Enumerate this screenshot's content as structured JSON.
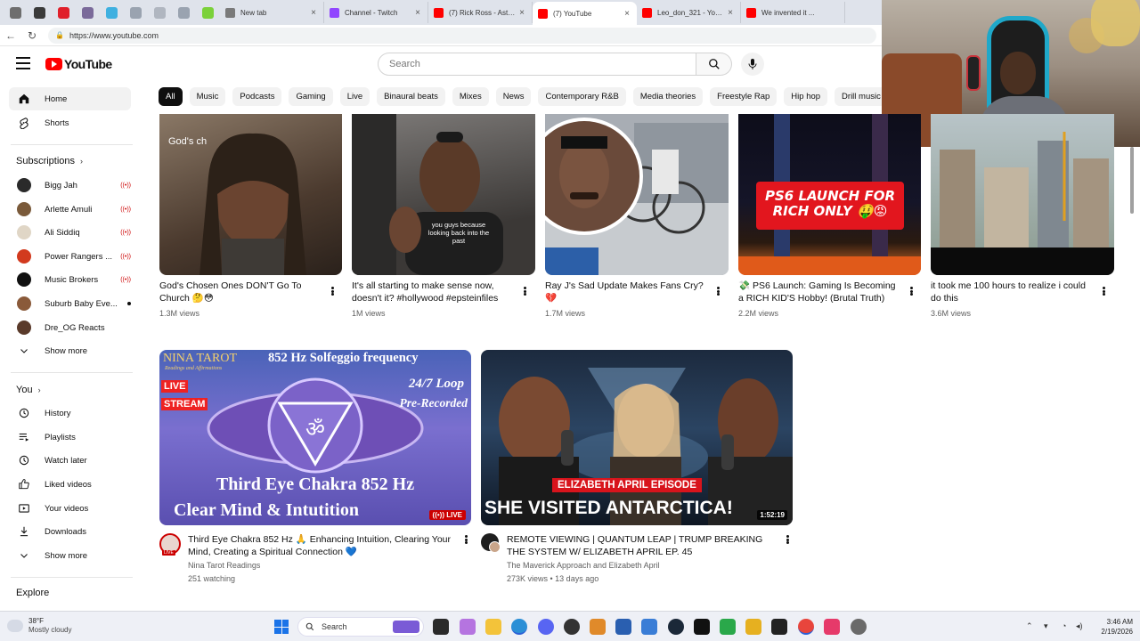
{
  "browser": {
    "tabs": [
      {
        "title": "New tab",
        "favicon_color": "#7a7a7a"
      },
      {
        "title": "Channel - Twitch",
        "favicon_color": "#9146ff"
      },
      {
        "title": "(7) Rick Ross - Aston M...",
        "favicon_color": "#ff0000"
      },
      {
        "title": "(7) YouTube",
        "favicon_color": "#ff0000",
        "active": true
      },
      {
        "title": "Leo_don_321 - YouTub...",
        "favicon_color": "#ff0000"
      },
      {
        "title": "We invented it ...",
        "favicon_color": "#ff0000"
      }
    ],
    "url": "https://www.youtube.com"
  },
  "header": {
    "logo_text": "YouTube",
    "search_placeholder": "Search"
  },
  "chips": [
    "All",
    "Music",
    "Podcasts",
    "Gaming",
    "Live",
    "Binaural beats",
    "Mixes",
    "News",
    "Contemporary R&B",
    "Media theories",
    "Freestyle Rap",
    "Hip hop",
    "Drill music"
  ],
  "sidebar": {
    "main": [
      {
        "label": "Home",
        "icon": "home-icon"
      },
      {
        "label": "Shorts",
        "icon": "shorts-icon"
      }
    ],
    "subscriptions_title": "Subscriptions",
    "subscriptions": [
      {
        "label": "Bigg Jah",
        "avatar_color": "#2a2a2a",
        "status": "live"
      },
      {
        "label": "Arlette Amuli",
        "avatar_color": "#7a5a3a",
        "status": "live"
      },
      {
        "label": "Ali Siddiq",
        "avatar_color": "#e0d6c6",
        "status": "live"
      },
      {
        "label": "Power Rangers ...",
        "avatar_color": "#d23a1e",
        "status": "live"
      },
      {
        "label": "Music Brokers",
        "avatar_color": "#111111",
        "status": "live"
      },
      {
        "label": "Suburb Baby Eve...",
        "avatar_color": "#8a5a3a",
        "status": "dot"
      },
      {
        "label": "Dre_OG Reacts",
        "avatar_color": "#5a3a2a",
        "status": ""
      }
    ],
    "show_more_1": "Show more",
    "you_title": "You",
    "you_items": [
      {
        "label": "History",
        "icon": "history-icon"
      },
      {
        "label": "Playlists",
        "icon": "playlists-icon"
      },
      {
        "label": "Watch later",
        "icon": "watch-later-icon"
      },
      {
        "label": "Liked videos",
        "icon": "like-icon"
      },
      {
        "label": "Your videos",
        "icon": "your-videos-icon"
      },
      {
        "label": "Downloads",
        "icon": "download-icon"
      }
    ],
    "show_more_2": "Show more",
    "explore_title": "Explore"
  },
  "videos_row1": [
    {
      "title": "God's Chosen Ones DON'T Go To Church 🤔😳",
      "meta": "1.3M views",
      "thumb_text": "God's ch",
      "thumb_bg": "#6b5a4c"
    },
    {
      "title": "It's all starting to make sense now, doesn't it? #hollywood #epsteinfiles",
      "meta": "1M views",
      "thumb_text": "you guys because looking back into the past",
      "thumb_bg": "#4f4a48"
    },
    {
      "title": "Ray J's Sad Update Makes Fans Cry? 💔",
      "meta": "1.7M views",
      "thumb_text": "",
      "thumb_bg": "#8a8f98"
    },
    {
      "title": "💸 PS6 Launch: Gaming Is Becoming a RICH KID'S Hobby! (Brutal Truth)",
      "meta": "2.2M views",
      "thumb_text": "PS6 LAUNCH FOR RICH ONLY 🤑😡",
      "thumb_bg": "#1a1a2a"
    },
    {
      "title": "it took me 100 hours to realize i could do this",
      "meta": "3.6M views",
      "thumb_text": "",
      "thumb_bg": "#9aa6a0"
    }
  ],
  "videos_row2": [
    {
      "title": "Third Eye Chakra 852 Hz 🙏 Enhancing Intuition, Clearing Your Mind, Creating a Spiritual Connection 💙",
      "channel": "Nina Tarot Readings",
      "meta": "251 watching",
      "thumb_top": "NINA TAROT",
      "thumb_sub": "Readings and Affirmations",
      "thumb_freq": "852 Hz Solfeggio frequency",
      "thumb_loop": "24/7 Loop",
      "thumb_pre": "Pre-Recorded",
      "thumb_live": "LIVE",
      "thumb_stream": "STREAM",
      "thumb_line1": "Third Eye Chakra 852 Hz",
      "thumb_line2": "Clear Mind & Intutition",
      "badge": "LIVE",
      "avatar_badge": "LIVE"
    },
    {
      "title": "REMOTE VIEWING | QUANTUM LEAP | TRUMP BREAKING THE SYSTEM W/ ELIZABETH APRIL EP. 45",
      "channel": "The Maverick Approach and Elizabeth April",
      "meta": "273K views • 13 days ago",
      "thumb_banner": "ELIZABETH APRIL EPISODE",
      "thumb_line": "SHE VISITED ANTARCTICA!",
      "duration": "1:52:19"
    }
  ],
  "taskbar": {
    "temp": "38°F",
    "weather": "Mostly cloudy",
    "search": "Search",
    "time": "3:46 AM",
    "date": "2/19/2026"
  }
}
